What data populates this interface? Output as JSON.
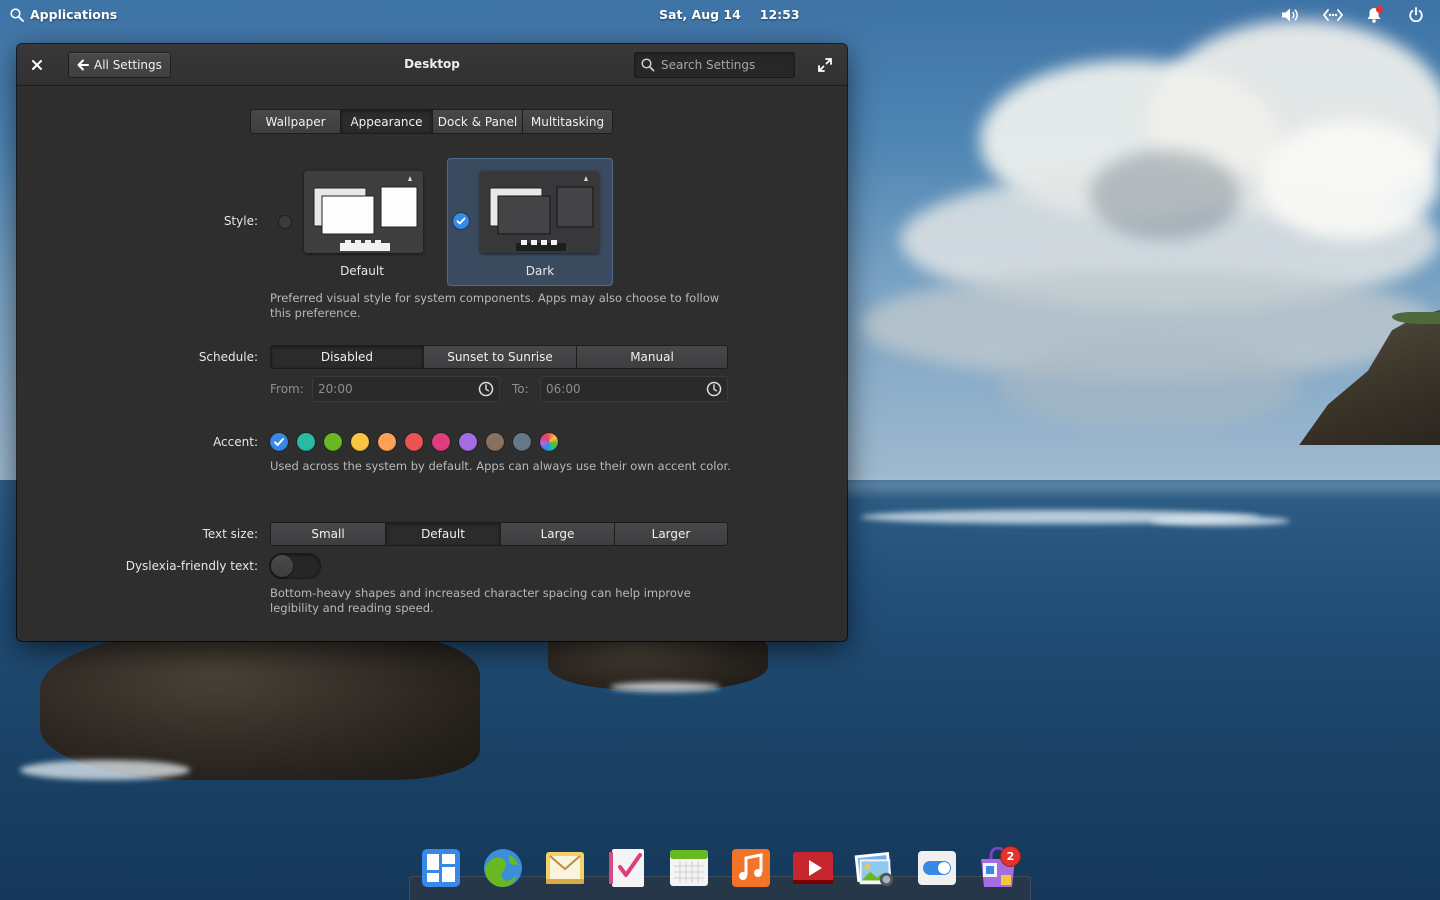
{
  "top_panel": {
    "applications_label": "Applications",
    "date": "Sat, Aug 14",
    "time": "12:53",
    "indicators": [
      "volume-icon",
      "network-icon",
      "notifications-icon",
      "power-icon"
    ]
  },
  "window": {
    "title": "Desktop",
    "back_label": "All Settings",
    "search_placeholder": "Search Settings"
  },
  "tabs": [
    {
      "label": "Wallpaper",
      "active": false
    },
    {
      "label": "Appearance",
      "active": true
    },
    {
      "label": "Dock & Panel",
      "active": false
    },
    {
      "label": "Multitasking",
      "active": false
    }
  ],
  "style": {
    "label": "Style:",
    "options": [
      {
        "label": "Default",
        "selected": false
      },
      {
        "label": "Dark",
        "selected": true
      }
    ],
    "description": "Preferred visual style for system components. Apps may also choose to follow this preference."
  },
  "schedule": {
    "label": "Schedule:",
    "options": [
      {
        "label": "Disabled",
        "active": true
      },
      {
        "label": "Sunset to Sunrise",
        "active": false
      },
      {
        "label": "Manual",
        "active": false
      }
    ],
    "from_label": "From:",
    "from_value": "20:00",
    "to_label": "To:",
    "to_value": "06:00"
  },
  "accent": {
    "label": "Accent:",
    "colors": [
      "#3689e6",
      "#28bca3",
      "#68b723",
      "#f9c440",
      "#ffa154",
      "#ed5353",
      "#de3e80",
      "#a56de2",
      "#8a715e",
      "#667885",
      "multicolor"
    ],
    "selected_index": 0,
    "description": "Used across the system by default. Apps can always use their own accent color."
  },
  "text_size": {
    "label": "Text size:",
    "options": [
      {
        "label": "Small",
        "active": false
      },
      {
        "label": "Default",
        "active": true
      },
      {
        "label": "Large",
        "active": false
      },
      {
        "label": "Larger",
        "active": false
      }
    ]
  },
  "dyslexia": {
    "label": "Dyslexia-friendly text:",
    "enabled": false,
    "description": "Bottom-heavy shapes and increased character spacing can help improve legibility and reading speed."
  },
  "dock": {
    "apps": [
      "multitasking-view-icon",
      "web-browser-icon",
      "mail-icon",
      "tasks-icon",
      "calendar-icon",
      "music-icon",
      "videos-icon",
      "photos-icon",
      "system-settings-icon",
      "appcenter-icon"
    ],
    "appcenter_badge": "2"
  }
}
